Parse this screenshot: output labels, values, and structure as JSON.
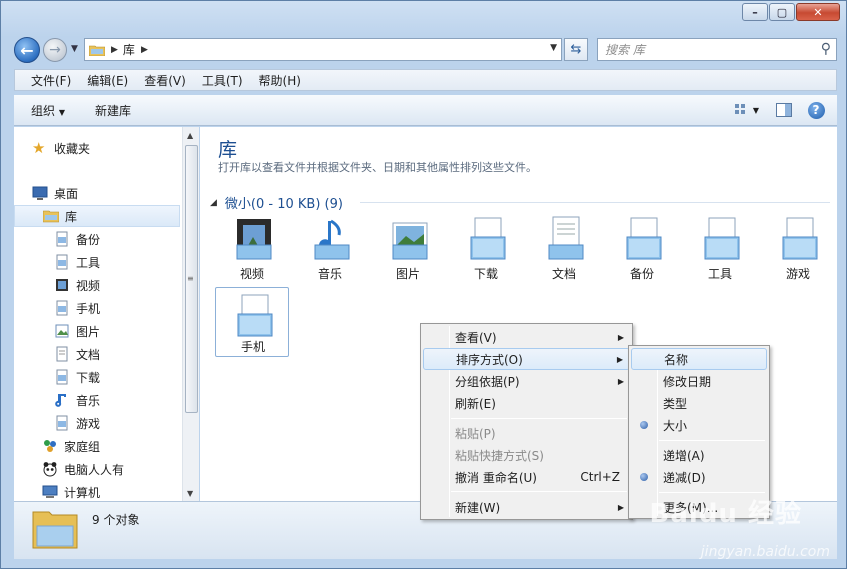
{
  "address": {
    "crumb": "库",
    "search_placeholder": "搜索 库"
  },
  "menubar": [
    "文件(F)",
    "编辑(E)",
    "查看(V)",
    "工具(T)",
    "帮助(H)"
  ],
  "toolbar": {
    "organize": "组织",
    "new_library": "新建库"
  },
  "nav": {
    "favorites": "收藏夹",
    "desktop": "桌面",
    "libraries": "库",
    "children": [
      "备份",
      "工具",
      "视频",
      "手机",
      "图片",
      "文档",
      "下载",
      "音乐",
      "游戏"
    ],
    "homegroup": "家庭组",
    "user": "电脑人人有",
    "computer": "计算机"
  },
  "content": {
    "title": "库",
    "description": "打开库以查看文件并根据文件夹、日期和其他属性排列这些文件。",
    "group_header": "微小(0 - 10 KB) (9)",
    "items": [
      "视频",
      "音乐",
      "图片",
      "下载",
      "文档",
      "备份",
      "工具",
      "游戏",
      "手机"
    ]
  },
  "status": {
    "count": "9 个对象"
  },
  "context_menu": {
    "view": "查看(V)",
    "sort": "排序方式(O)",
    "group": "分组依据(P)",
    "refresh": "刷新(E)",
    "paste": "粘贴(P)",
    "paste_shortcut": "粘贴快捷方式(S)",
    "undo": "撤消 重命名(U)",
    "undo_shortcut": "Ctrl+Z",
    "new": "新建(W)"
  },
  "sort_menu": {
    "name": "名称",
    "date_modified": "修改日期",
    "type": "类型",
    "size": "大小",
    "ascending": "递增(A)",
    "descending": "递减(D)",
    "more": "更多(M)..."
  },
  "watermark": {
    "brand": "Baidu 经验",
    "url": "jingyan.baidu.com"
  },
  "colors": {
    "title_blue": "#1d4f91",
    "menu_highlight": "#dcebfa",
    "window_frame": "#bcd3ec"
  }
}
